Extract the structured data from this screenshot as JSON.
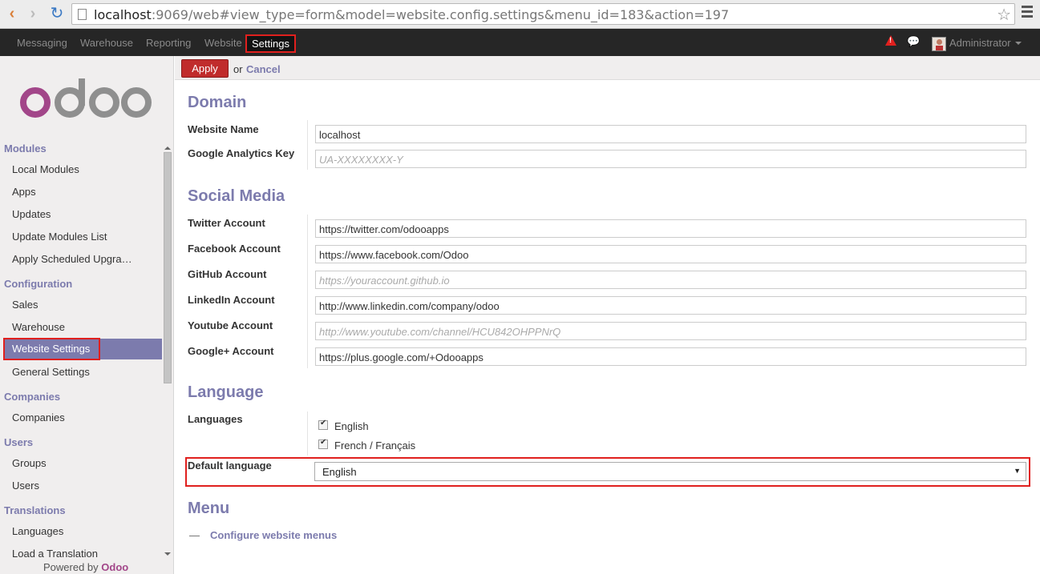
{
  "browser": {
    "url_host": "localhost",
    "url_rest": ":9069/web#view_type=form&model=website.config.settings&menu_id=183&action=197"
  },
  "topnav": {
    "items": [
      "Messaging",
      "Warehouse",
      "Reporting",
      "Website",
      "Settings"
    ],
    "active": "Settings",
    "user": "Administrator"
  },
  "sidebar": {
    "sections": [
      {
        "title": "Modules",
        "items": [
          "Local Modules",
          "Apps",
          "Updates",
          "Update Modules List",
          "Apply Scheduled Upgra…"
        ]
      },
      {
        "title": "Configuration",
        "items": [
          "Sales",
          "Warehouse",
          "Website Settings",
          "General Settings"
        ]
      },
      {
        "title": "Companies",
        "items": [
          "Companies"
        ]
      },
      {
        "title": "Users",
        "items": [
          "Groups",
          "Users"
        ]
      },
      {
        "title": "Translations",
        "items": [
          "Languages",
          "Load a Translation"
        ]
      }
    ],
    "selected": "Website Settings",
    "powered_by": "Powered by",
    "powered_brand": "Odoo"
  },
  "actions": {
    "apply": "Apply",
    "or": "or",
    "cancel": "Cancel"
  },
  "domain": {
    "title": "Domain",
    "website_name_label": "Website Name",
    "website_name_value": "localhost",
    "ga_key_label": "Google Analytics Key",
    "ga_key_placeholder": "UA-XXXXXXXX-Y"
  },
  "social": {
    "title": "Social Media",
    "twitter_label": "Twitter Account",
    "twitter_value": "https://twitter.com/odooapps",
    "facebook_label": "Facebook Account",
    "facebook_value": "https://www.facebook.com/Odoo",
    "github_label": "GitHub Account",
    "github_placeholder": "https://youraccount.github.io",
    "linkedin_label": "LinkedIn Account",
    "linkedin_value": "http://www.linkedin.com/company/odoo",
    "youtube_label": "Youtube Account",
    "youtube_placeholder": "http://www.youtube.com/channel/HCU842OHPPNrQ",
    "googleplus_label": "Google+ Account",
    "googleplus_value": "https://plus.google.com/+Odooapps"
  },
  "language": {
    "title": "Language",
    "languages_label": "Languages",
    "lang1": "English",
    "lang2": "French / Français",
    "default_label": "Default language",
    "default_value": "English"
  },
  "menu": {
    "title": "Menu",
    "configure_link": "Configure website menus"
  },
  "colors": {
    "accent": "#7c7bad",
    "apply": "#c02c2c",
    "highlight": "#e0201e",
    "navbar": "#262626"
  }
}
